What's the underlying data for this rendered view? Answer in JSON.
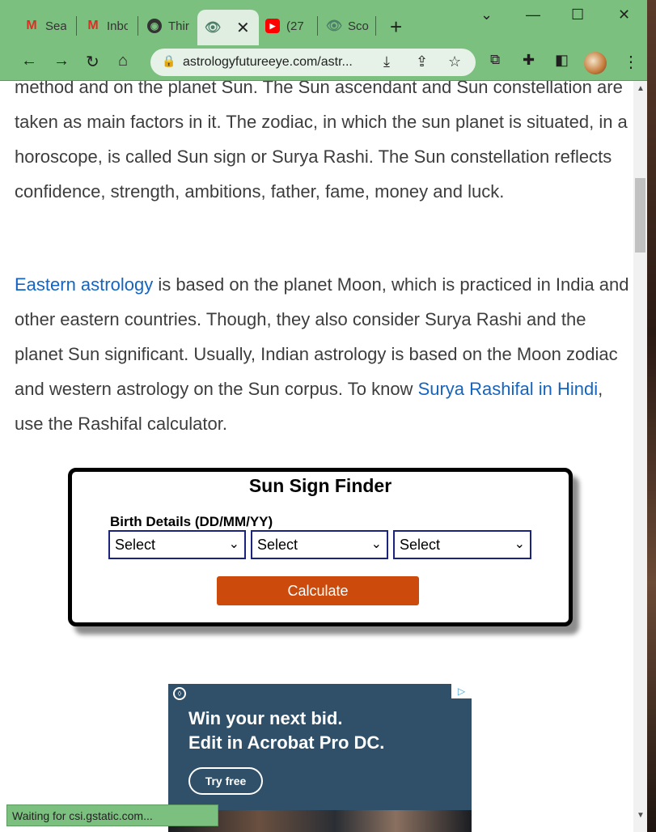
{
  "browser": {
    "tabs": [
      {
        "title": "Sea",
        "icon": "gmail-icon"
      },
      {
        "title": "Inbo",
        "icon": "gmail-icon"
      },
      {
        "title": "Thir",
        "icon": "globe-icon"
      },
      {
        "title": "",
        "icon": "eye-icon",
        "active": true
      },
      {
        "title": "(27",
        "icon": "youtube-icon"
      },
      {
        "title": "Sco",
        "icon": "eye-icon"
      }
    ],
    "url": "astrologyfutureeye.com/astr...",
    "status": "Waiting for csi.gstatic.com..."
  },
  "article": {
    "para1": "method and on the planet Sun. The Sun ascendant and Sun constellation are taken as main factors in it. The zodiac, in which the sun planet is situated, in a horoscope, is called Sun sign or Surya Rashi. The Sun constellation reflects confidence, strength, ambitions, father, fame, money and luck.",
    "para2_link1": "Eastern astrology",
    "para2_text1": " is based on the planet Moon, which is practiced in India and other eastern countries. Though, they also consider Surya Rashi and the planet Sun significant. Usually, Indian astrology is based on the Moon zodiac and western astrology on the Sun corpus. To know ",
    "para2_link2": "Surya Rashifal in Hindi",
    "para2_text2": ", use the Rashifal calculator."
  },
  "finder": {
    "title": "Sun Sign Finder",
    "birth_label": "Birth Details (DD/MM/YY)",
    "day_select": "Select",
    "month_select": "Select",
    "year_select": "Select",
    "calculate": "Calculate"
  },
  "ad": {
    "line1": "Win your next bid.",
    "line2": "Edit in Acrobat Pro DC.",
    "button": "Try free"
  },
  "colors": {
    "chrome": "#7cc07f",
    "link": "#1565c0",
    "calculate_button": "#cc4a0b",
    "ad_background": "#2f5068"
  }
}
